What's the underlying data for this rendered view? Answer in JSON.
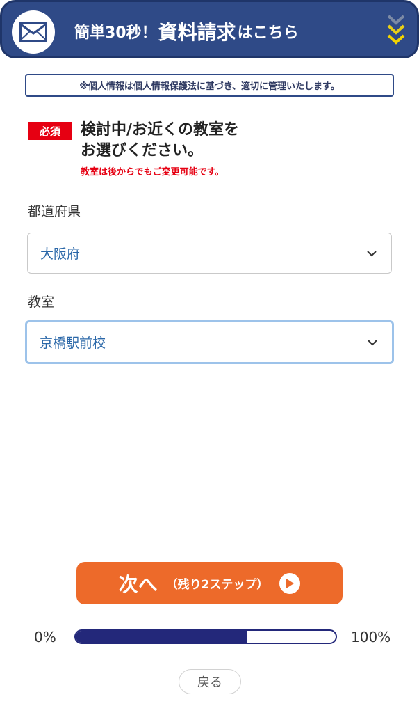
{
  "header": {
    "title_prefix": "簡単30秒！",
    "title_main": "資料請求",
    "title_suffix": "はこちら",
    "icon": "envelope-icon",
    "accent": "#2f4a87",
    "chevron_color": "#f2d300"
  },
  "notice": {
    "text": "※個人情報は個人情報保護法に基づき、適切に管理いたします。"
  },
  "question": {
    "badge": "必須",
    "title_line1": "検討中/お近くの教室を",
    "title_line2": "お選びください。",
    "note": "教室は後からでもご変更可能です。"
  },
  "fields": {
    "prefecture": {
      "label": "都道府県",
      "value": "大阪府"
    },
    "classroom": {
      "label": "教室",
      "value": "京橋駅前校"
    }
  },
  "next_button": {
    "main": "次へ",
    "sub": "（残り2ステップ）",
    "icon": "play-circle-icon",
    "color": "#ed6a2a"
  },
  "progress": {
    "min_label": "0%",
    "max_label": "100%",
    "value_percent": 66
  },
  "back_button": {
    "label": "戻る"
  }
}
